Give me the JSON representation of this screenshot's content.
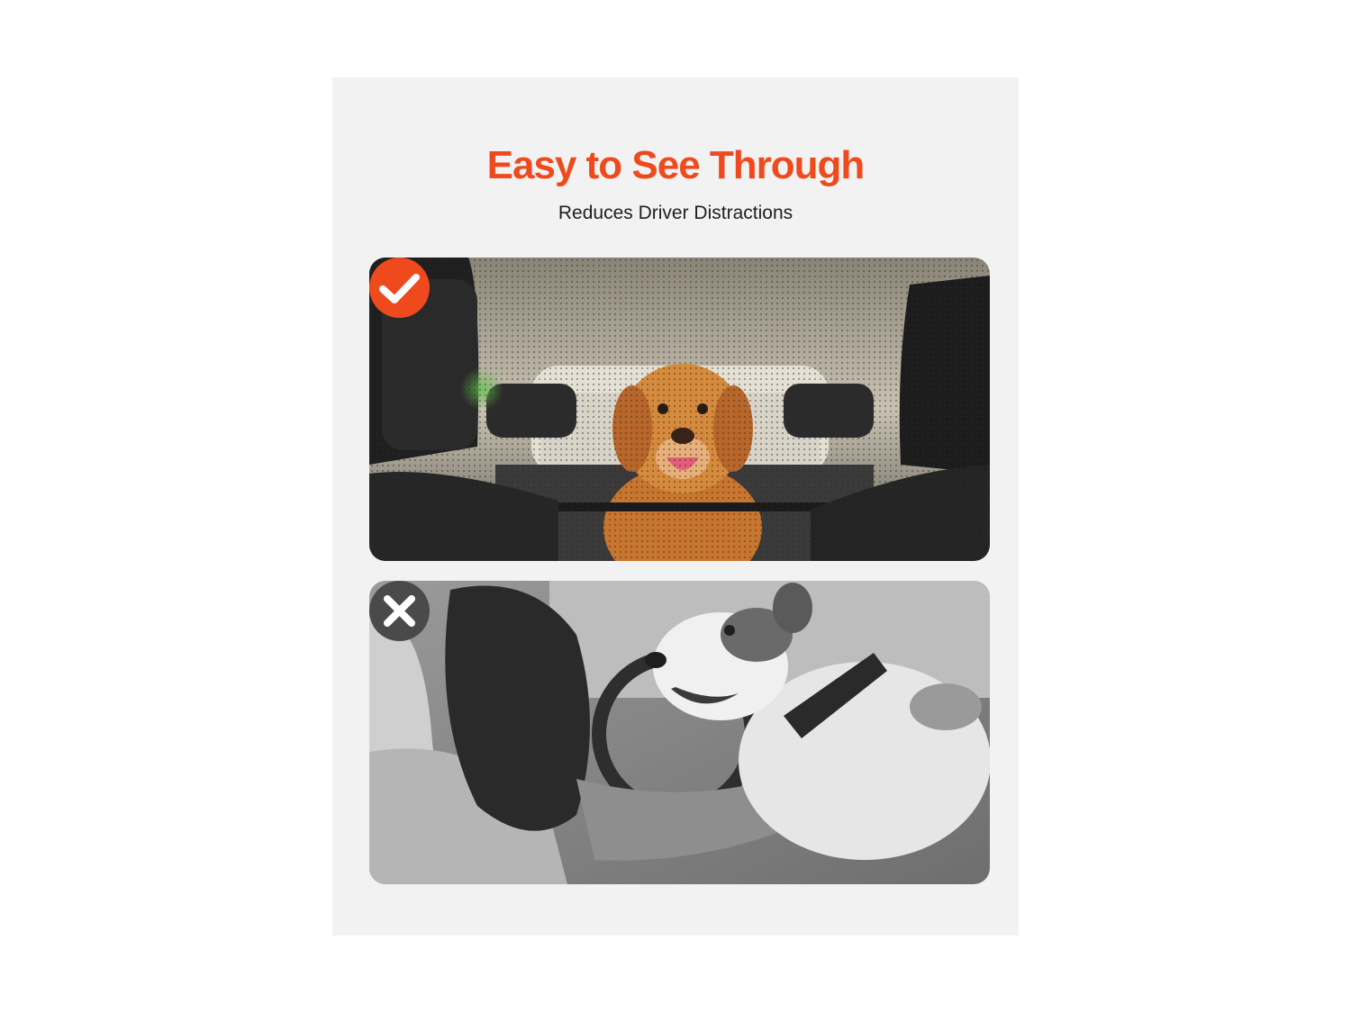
{
  "header": {
    "title": "Easy to See Through",
    "subtitle": "Reduces Driver Distractions"
  },
  "panels": [
    {
      "name": "good-example",
      "icon": "check-icon",
      "description_visual": "golden retriever behind mesh barrier in car back seat, color photo"
    },
    {
      "name": "bad-example",
      "icon": "close-icon",
      "description_visual": "driver hugging dog in front seat, grayscale photo"
    }
  ],
  "colors": {
    "accent": "#ee4a1d",
    "card_background": "#f2f2f2",
    "bad_badge": "#4a4a4a",
    "subtitle_text": "#1f1f1f"
  }
}
